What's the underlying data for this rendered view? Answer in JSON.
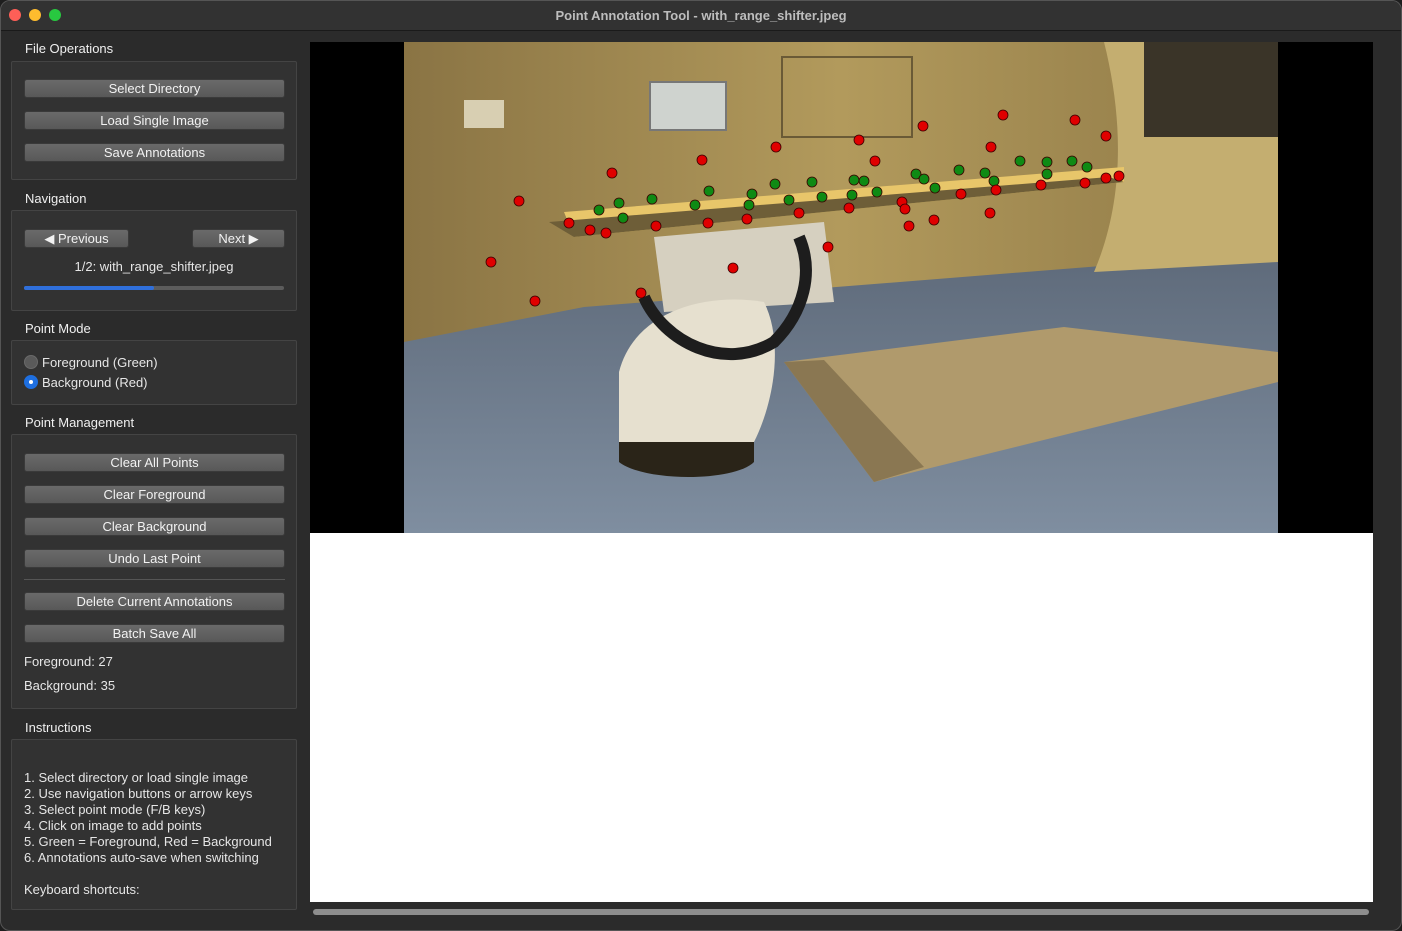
{
  "window": {
    "title": "Point Annotation Tool - with_range_shifter.jpeg"
  },
  "file_operations": {
    "title": "File Operations",
    "select_directory": "Select Directory",
    "load_single_image": "Load Single Image",
    "save_annotations": "Save Annotations"
  },
  "navigation": {
    "title": "Navigation",
    "previous": "◀ Previous",
    "next": "Next ▶",
    "status": "1/2: with_range_shifter.jpeg",
    "current_index": 1,
    "total": 2,
    "progress_fraction": 0.5
  },
  "point_mode": {
    "title": "Point Mode",
    "options": [
      "Foreground (Green)",
      "Background (Red)"
    ],
    "selected": "Background (Red)"
  },
  "point_management": {
    "title": "Point Management",
    "clear_all": "Clear All Points",
    "clear_foreground": "Clear Foreground",
    "clear_background": "Clear Background",
    "undo_last": "Undo Last Point",
    "delete_current": "Delete Current Annotations",
    "batch_save": "Batch Save All",
    "foreground_count": "Foreground: 27",
    "background_count": "Background: 35"
  },
  "instructions": {
    "title": "Instructions",
    "lines": [
      "1. Select directory or load single image",
      "2. Use navigation buttons or arrow keys",
      "3. Select point mode (F/B keys)",
      "4. Click on image to add points",
      "5. Green = Foreground, Red = Background",
      "6. Annotations auto-save when switching"
    ],
    "shortcuts_label": "Keyboard shortcuts:"
  },
  "colors": {
    "foreground_point": "#0f8a14",
    "background_point": "#e00000",
    "accent": "#2f6fdb"
  }
}
